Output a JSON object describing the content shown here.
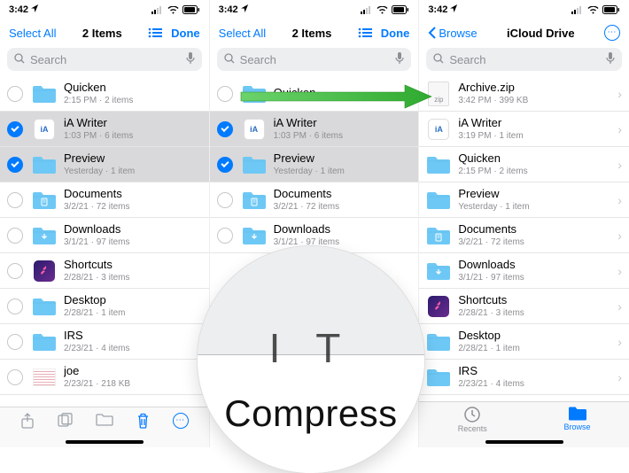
{
  "status": {
    "time": "3:42",
    "loc_arrow": "➤"
  },
  "screen1": {
    "nav": {
      "left": "Select All",
      "title": "2 Items",
      "right": "Done"
    },
    "search_placeholder": "Search",
    "rows": [
      {
        "title": "Quicken",
        "sub": "2:15 PM · 2 items",
        "selected": false,
        "icon": "folder"
      },
      {
        "title": "iA Writer",
        "sub": "1:03 PM · 6 items",
        "selected": true,
        "icon": "app-ia"
      },
      {
        "title": "Preview",
        "sub": "Yesterday · 1 item",
        "selected": true,
        "icon": "folder"
      },
      {
        "title": "Documents",
        "sub": "3/2/21 · 72 items",
        "selected": false,
        "icon": "folder-doc"
      },
      {
        "title": "Downloads",
        "sub": "3/1/21 · 97 items",
        "selected": false,
        "icon": "folder-down"
      },
      {
        "title": "Shortcuts",
        "sub": "2/28/21 · 3 items",
        "selected": false,
        "icon": "app-shortcuts"
      },
      {
        "title": "Desktop",
        "sub": "2/28/21 · 1 item",
        "selected": false,
        "icon": "folder"
      },
      {
        "title": "IRS",
        "sub": "2/23/21 · 4 items",
        "selected": false,
        "icon": "folder"
      },
      {
        "title": "joe",
        "sub": "2/23/21 · 218 KB",
        "selected": false,
        "icon": "file-joe"
      }
    ]
  },
  "screen2": {
    "nav": {
      "left": "Select All",
      "title": "2 Items",
      "right": "Done"
    },
    "search_placeholder": "Search",
    "rows": [
      {
        "title": "Quicken",
        "sub": "",
        "selected": false,
        "icon": "folder"
      },
      {
        "title": "iA Writer",
        "sub": "1:03 PM · 6 items",
        "selected": true,
        "icon": "app-ia"
      },
      {
        "title": "Preview",
        "sub": "Yesterday · 1 item",
        "selected": true,
        "icon": "folder"
      },
      {
        "title": "Documents",
        "sub": "3/2/21 · 72 items",
        "selected": false,
        "icon": "folder-doc"
      },
      {
        "title": "Downloads",
        "sub": "3/1/21 · 97 items",
        "selected": false,
        "icon": "folder-down"
      }
    ],
    "magnifier_word": "Compress"
  },
  "screen3": {
    "nav": {
      "back": "Browse",
      "title": "iCloud Drive"
    },
    "search_placeholder": "Search",
    "rows": [
      {
        "title": "Archive.zip",
        "sub": "3:42 PM · 399 KB",
        "icon": "zip"
      },
      {
        "title": "iA Writer",
        "sub": "3:19 PM · 1 item",
        "icon": "app-ia"
      },
      {
        "title": "Quicken",
        "sub": "2:15 PM · 2 items",
        "icon": "folder"
      },
      {
        "title": "Preview",
        "sub": "Yesterday · 1 item",
        "icon": "folder"
      },
      {
        "title": "Documents",
        "sub": "3/2/21 · 72 items",
        "icon": "folder-doc"
      },
      {
        "title": "Downloads",
        "sub": "3/1/21 · 97 items",
        "icon": "folder-down"
      },
      {
        "title": "Shortcuts",
        "sub": "2/28/21 · 3 items",
        "icon": "app-shortcuts"
      },
      {
        "title": "Desktop",
        "sub": "2/28/21 · 1 item",
        "icon": "folder"
      },
      {
        "title": "IRS",
        "sub": "2/23/21 · 4 items",
        "icon": "folder"
      }
    ],
    "tabs": {
      "recents": "Recents",
      "browse": "Browse"
    }
  }
}
